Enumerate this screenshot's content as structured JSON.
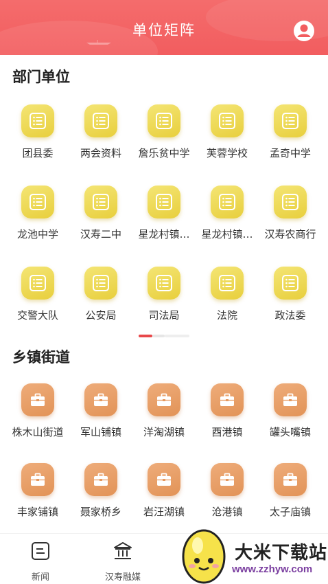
{
  "header": {
    "title": "单位矩阵",
    "bg_color": "#f25d5f",
    "user_icon": "user-avatar-icon"
  },
  "departments": {
    "title": "部门单位",
    "icon": "list-document-icon",
    "tile_color": "#ead244",
    "items": [
      {
        "label": "团县委"
      },
      {
        "label": "两会资料"
      },
      {
        "label": "詹乐贫中学"
      },
      {
        "label": "芙蓉学校"
      },
      {
        "label": "孟奇中学"
      },
      {
        "label": "龙池中学"
      },
      {
        "label": "汉寿二中"
      },
      {
        "label": "星龙村镇…"
      },
      {
        "label": "星龙村镇…"
      },
      {
        "label": "汉寿农商行"
      },
      {
        "label": "交警大队"
      },
      {
        "label": "公安局"
      },
      {
        "label": "司法局"
      },
      {
        "label": "法院"
      },
      {
        "label": "政法委"
      }
    ],
    "pager": {
      "pages": 3,
      "active": 1,
      "active_color": "#e8484a"
    }
  },
  "towns": {
    "title": "乡镇街道",
    "icon": "briefcase-icon",
    "tile_color": "#e5995e",
    "items": [
      {
        "label": "株木山街道"
      },
      {
        "label": "军山铺镇"
      },
      {
        "label": "洋淘湖镇"
      },
      {
        "label": "酉港镇"
      },
      {
        "label": "罐头嘴镇"
      },
      {
        "label": "丰家铺镇"
      },
      {
        "label": "聂家桥乡"
      },
      {
        "label": "岩汪湖镇"
      },
      {
        "label": "沧港镇"
      },
      {
        "label": "太子庙镇"
      }
    ]
  },
  "tabbar": {
    "tabs": [
      {
        "label": "新闻",
        "icon": "news-icon"
      },
      {
        "label": "汉寿融媒",
        "icon": "bank-building-icon"
      }
    ]
  },
  "watermark": {
    "name": "大米下载站",
    "url": "www.zzhyw.com",
    "logo": "rice-egg-mascot-logo"
  }
}
